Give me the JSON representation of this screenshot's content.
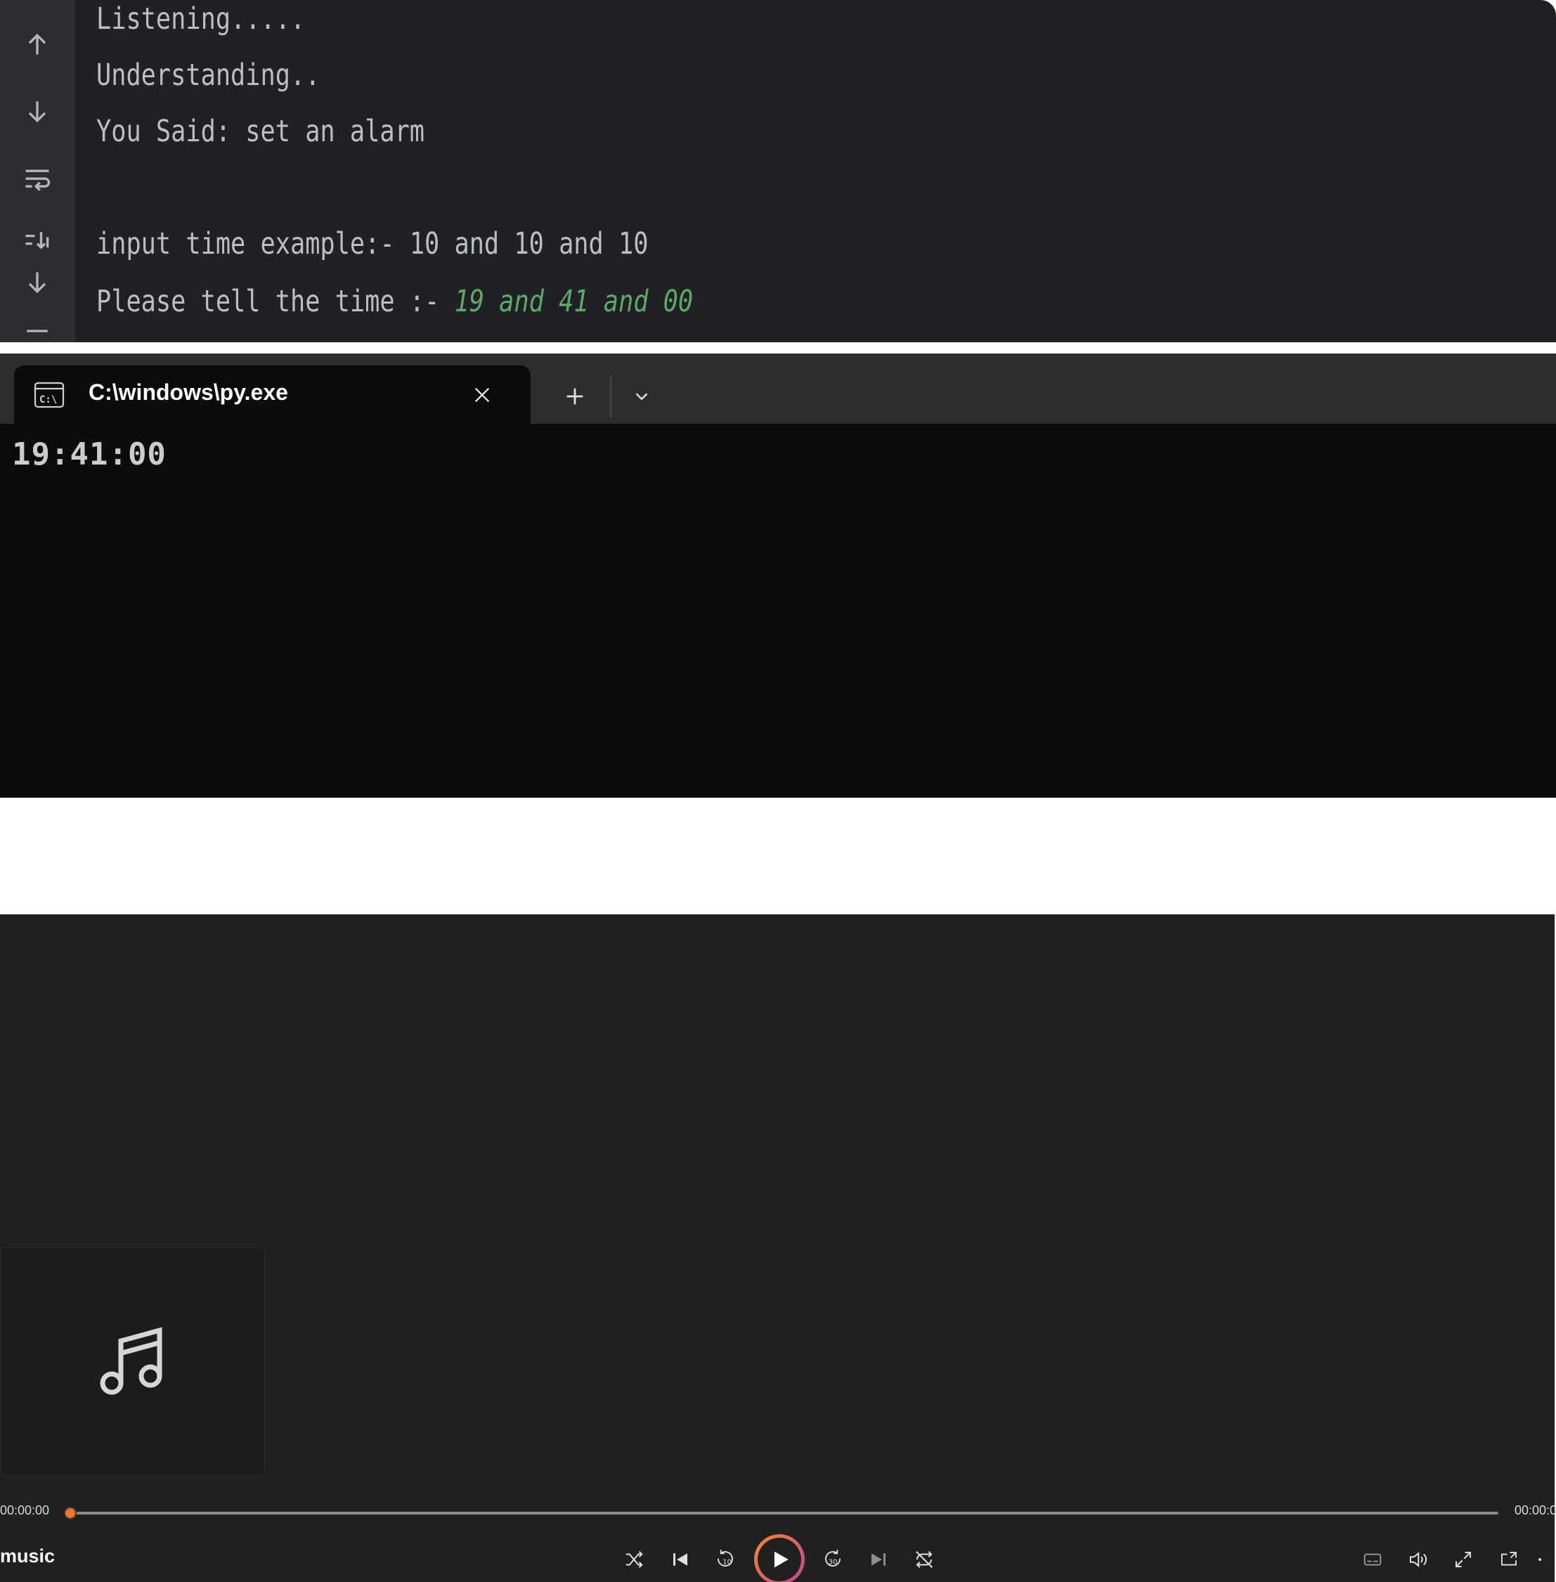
{
  "ide_console": {
    "lines": [
      "Listening.....",
      "Understanding..",
      "You Said: set an alarm",
      "",
      "input time example:- 10 and 10 and 10"
    ],
    "prompt_text": "Please tell the time :- ",
    "user_input": "19 and 41 and 00",
    "gutter_icons": [
      "arrow-up-icon",
      "arrow-down-icon",
      "soft-wrap-icon",
      "scroll-to-end-icon",
      "download-arrow-icon",
      "menu-icon"
    ]
  },
  "terminal": {
    "tab_title": "C:\\windows\\py.exe",
    "tab_icon": "cmd-icon",
    "output": "19:41:00"
  },
  "media_player": {
    "current_time": "00:00:00",
    "total_time": "00:00:0",
    "title": "music",
    "progress_fraction": 0.0,
    "accent_color": "#f0732e",
    "artwork_icon": "music-note-icon"
  },
  "colors": {
    "ide_background": "#1f2125",
    "ide_text": "#bcbec4",
    "input_text": "#5fa86a",
    "terminal_background": "#0c0c0c",
    "player_background": "#202020"
  }
}
